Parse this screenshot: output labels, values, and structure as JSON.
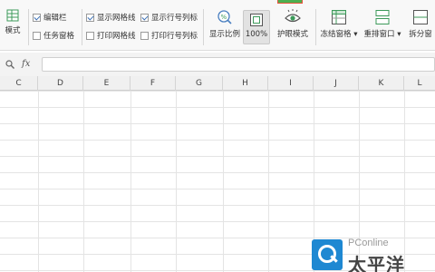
{
  "ribbon": {
    "mode_label": "模式",
    "checkboxes": [
      {
        "label": "编辑栏",
        "checked": true
      },
      {
        "label": "任务窗格",
        "checked": false
      },
      {
        "label": "显示网格线",
        "checked": true
      },
      {
        "label": "打印网格线",
        "checked": false
      },
      {
        "label": "显示行号列标",
        "checked": true
      },
      {
        "label": "打印行号列标",
        "checked": false
      }
    ],
    "buttons": {
      "display_ratio": "显示比例",
      "zoom_100": "100%",
      "eye_mode": "护眼模式",
      "freeze_panes": "冻结窗格",
      "rearrange_window": "重排窗口",
      "split_window": "拆分窗"
    }
  },
  "formula_bar": {
    "fx": "fx",
    "value": ""
  },
  "grid": {
    "columns": [
      "C",
      "D",
      "E",
      "F",
      "G",
      "H",
      "I",
      "J",
      "K",
      "L"
    ]
  },
  "watermark": {
    "brand": "PConline",
    "cn": "太平洋"
  },
  "colors": {
    "accent_blue": "#3a6fb5",
    "indicator_green": "#4caf50",
    "indicator_red": "#e8543c",
    "watermark_blue": "#1e88d2"
  }
}
